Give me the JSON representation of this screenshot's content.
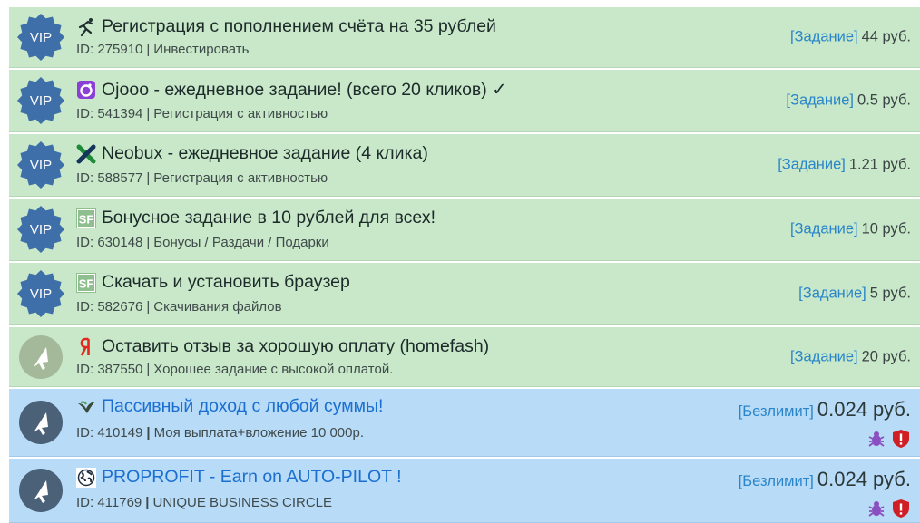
{
  "rows": [
    {
      "title": "Регистрация с пополнением счёта на 35 рублей",
      "id_text": "ID: 275910",
      "category": "Инвестировать",
      "tag": "[Задание]",
      "price": "44 руб.",
      "badge": "vip",
      "badge_text": "VIP",
      "icon": "runner-icon"
    },
    {
      "title": "Ojooo - ежедневное задание! (всего 20 кликов) ✓",
      "id_text": "ID: 541394",
      "category": "Регистрация с активностью",
      "tag": "[Задание]",
      "price": "0.5 руб.",
      "badge": "vip",
      "badge_text": "VIP",
      "icon": "ojooo-icon"
    },
    {
      "title": "Neobux - ежедневное задание (4 клика)",
      "id_text": "ID: 588577",
      "category": "Регистрация с активностью",
      "tag": "[Задание]",
      "price": "1.21 руб.",
      "badge": "vip",
      "badge_text": "VIP",
      "icon": "neobux-icon"
    },
    {
      "title": "Бонусное задание в 10 рублей для всех!",
      "id_text": "ID: 630148",
      "category": "Бонусы / Раздачи / Подарки",
      "tag": "[Задание]",
      "price": "10 руб.",
      "badge": "vip",
      "badge_text": "VIP",
      "icon": "sf-icon"
    },
    {
      "title": "Скачать и установить браузер",
      "id_text": "ID: 582676",
      "category": "Скачивания файлов",
      "tag": "[Задание]",
      "price": "5 руб.",
      "badge": "vip",
      "badge_text": "VIP",
      "icon": "sf-icon"
    },
    {
      "title": "Оставить отзыв за хорошую оплату (homefash)",
      "id_text": "ID: 387550",
      "category": "Хорошее задание с высокой оплатой.",
      "tag": "[Задание]",
      "price": "20 руб.",
      "badge": "cursor-green",
      "icon": "yandex-icon"
    },
    {
      "title": "Пассивный доход с любой суммы!",
      "id_text": "ID: 410149",
      "category": "Моя выплата+вложение 10 000р.",
      "tag": "[Безлимит]",
      "price": "0.024 руб.",
      "badge": "cursor-blue",
      "icon": "bird-icon",
      "secure": true
    },
    {
      "title": "PROPROFIT - Earn on AUTO-PILOT !",
      "id_text": "ID: 411769",
      "category": "UNIQUE BUSINESS CIRCLE",
      "tag": "[Безлимит]",
      "price": "0.024 руб.",
      "badge": "cursor-blue",
      "icon": "globe-icon",
      "secure": true
    }
  ],
  "separator": "|",
  "colors": {
    "green_row": "#c8e8c9",
    "blue_row": "#b8dbf8",
    "vip_badge": "#3f6fa8",
    "link": "#1a6fd0",
    "tag": "#2a86c9"
  }
}
